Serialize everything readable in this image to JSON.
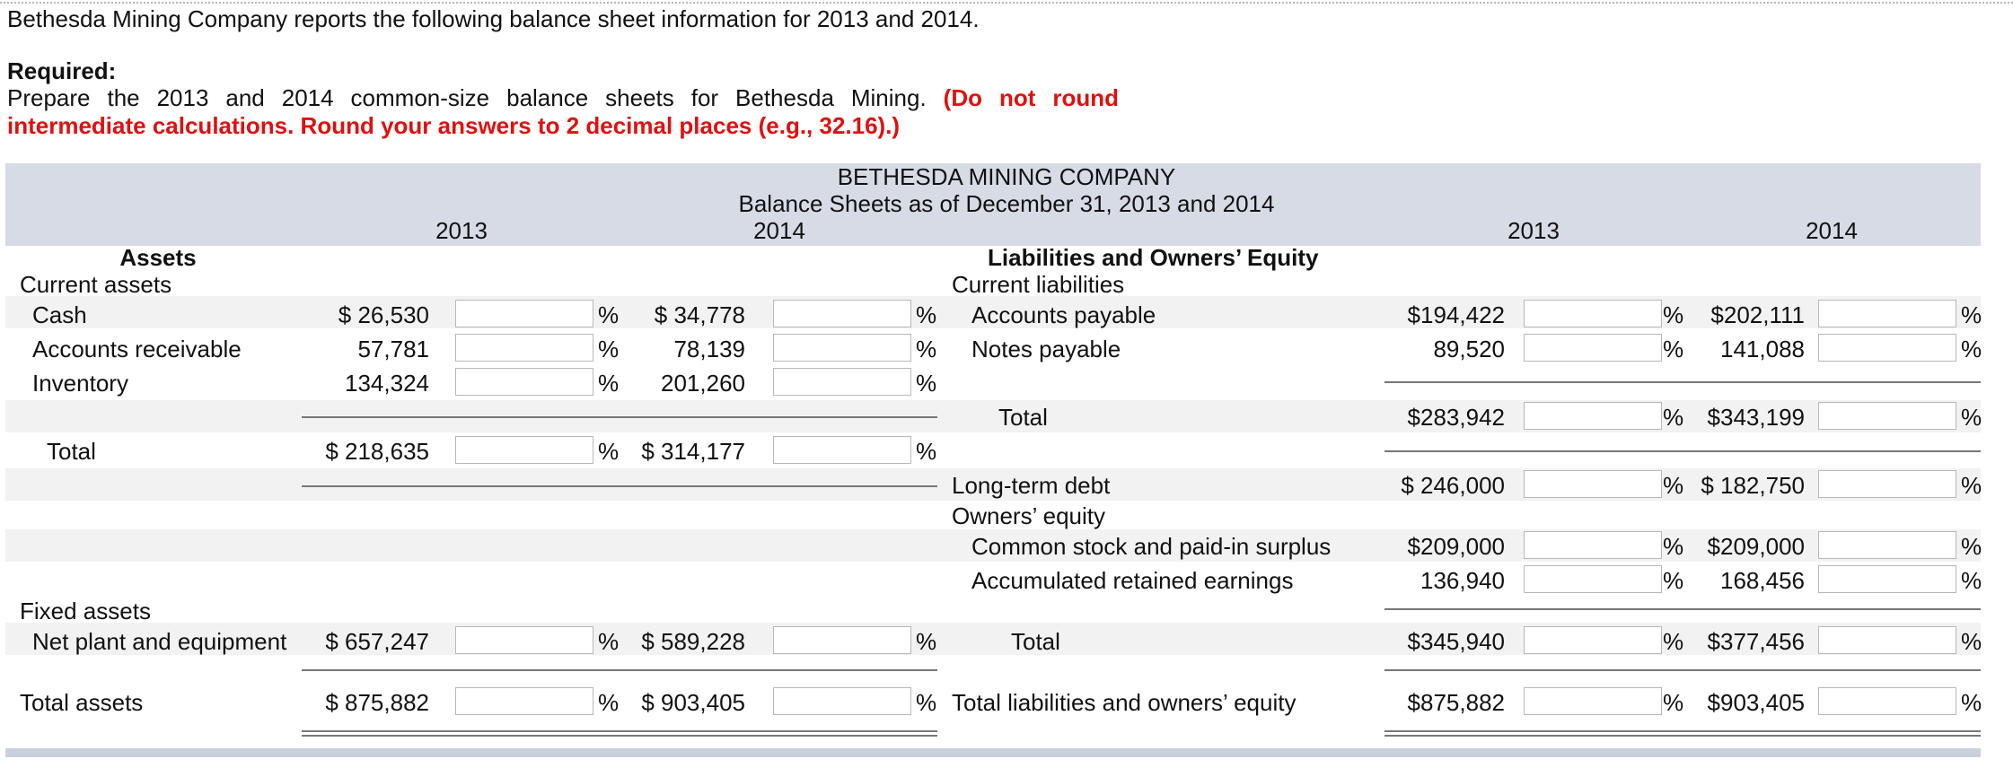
{
  "intro": "Bethesda Mining Company reports the following balance sheet information for 2013 and 2014.",
  "required_label": "Required:",
  "instruction": "Prepare the 2013 and 2014 common-size balance sheets for Bethesda Mining.",
  "instruction_note": "(Do not round intermediate calculations. Round your answers to 2 decimal places (e.g., 32.16).)",
  "header": {
    "company": "BETHESDA MINING COMPANY",
    "subtitle": "Balance Sheets as of December 31, 2013 and 2014",
    "year1": "2013",
    "year2": "2014"
  },
  "assets": {
    "heading": "Assets",
    "current_label": "Current assets",
    "cash": {
      "label": "Cash",
      "v2013": "$ 26,530",
      "v2014": "$ 34,778"
    },
    "ar": {
      "label": "Accounts receivable",
      "v2013": "57,781",
      "v2014": "78,139"
    },
    "inventory": {
      "label": "Inventory",
      "v2013": "134,324",
      "v2014": "201,260"
    },
    "total": {
      "label": "Total",
      "v2013": "$ 218,635",
      "v2014": "$ 314,177"
    },
    "fixed_label": "Fixed assets",
    "nppe": {
      "label": "Net plant and equipment",
      "v2013": "$ 657,247",
      "v2014": "$ 589,228"
    },
    "total_assets": {
      "label": "Total assets",
      "v2013": "$ 875,882",
      "v2014": "$ 903,405"
    }
  },
  "liabilities": {
    "heading": "Liabilities and Owners’ Equity",
    "current_label": "Current liabilities",
    "ap": {
      "label": "Accounts payable",
      "v2013": "$194,422",
      "v2014": "$202,111"
    },
    "np": {
      "label": "Notes payable",
      "v2013": "89,520",
      "v2014": "141,088"
    },
    "total_cl": {
      "label": "Total",
      "v2013": "$283,942",
      "v2014": "$343,199"
    },
    "ltd": {
      "label": "Long-term debt",
      "v2013": "$ 246,000",
      "v2014": "$ 182,750"
    },
    "equity_label": "Owners’ equity",
    "cs": {
      "label": "Common stock and paid-in surplus",
      "v2013": "$209,000",
      "v2014": "$209,000"
    },
    "re": {
      "label": "Accumulated retained earnings",
      "v2013": "136,940",
      "v2014": "168,456"
    },
    "total_eq": {
      "label": "Total",
      "v2013": "$345,940",
      "v2014": "$377,456"
    },
    "total_le": {
      "label": "Total liabilities and owners’ equity",
      "v2013": "$875,882",
      "v2014": "$903,405"
    }
  },
  "pct": "%"
}
